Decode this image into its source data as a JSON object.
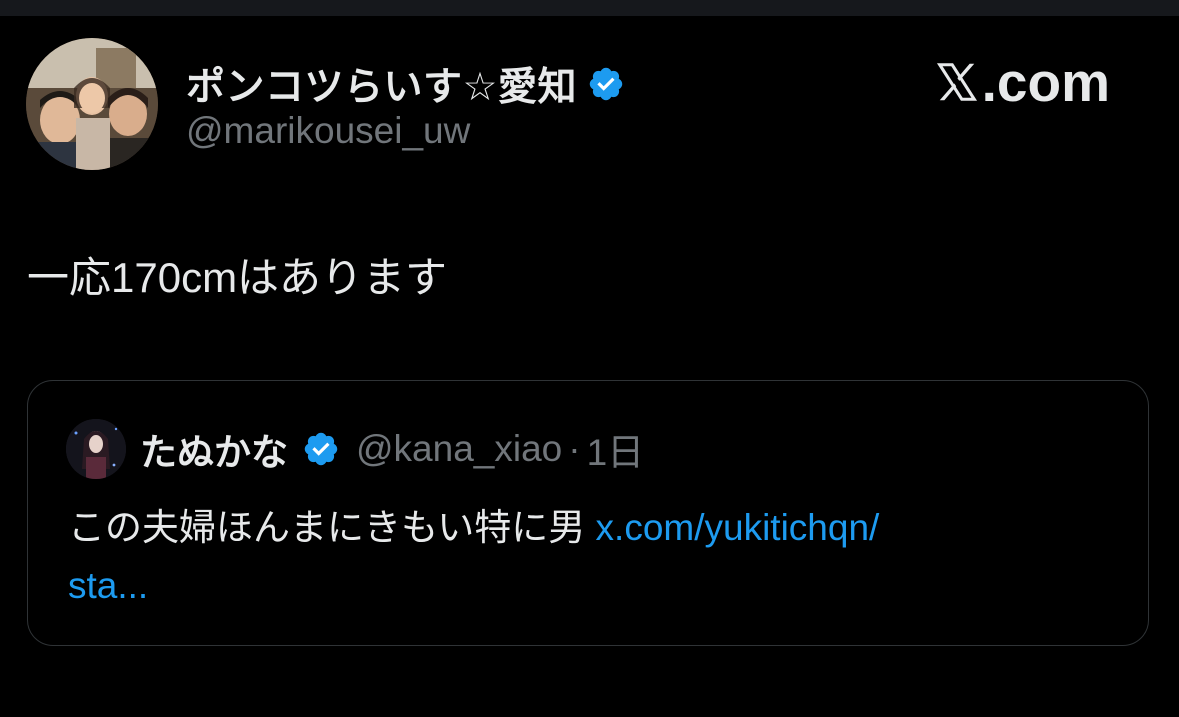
{
  "colors": {
    "background": "#000000",
    "text": "#e7e9ea",
    "muted": "#71767b",
    "accent": "#1d9bf0",
    "border": "#2f3336"
  },
  "author": {
    "display_name": "ポンコツらいす☆愛知",
    "handle": "@marikousei_uw",
    "verified_icon": "verified-badge-icon"
  },
  "brand": {
    "text": ".com",
    "icon": "x-logo-icon"
  },
  "tweet": {
    "text": "一応170cmはあります"
  },
  "quoted_tweet": {
    "display_name": "たぬかな",
    "handle": "@kana_xiao",
    "separator": "·",
    "time": "1日",
    "body_text": "この夫婦ほんまにきもい特に男 ",
    "link_line1": "x.com/yukitichqn/",
    "link_line2": "sta..."
  }
}
